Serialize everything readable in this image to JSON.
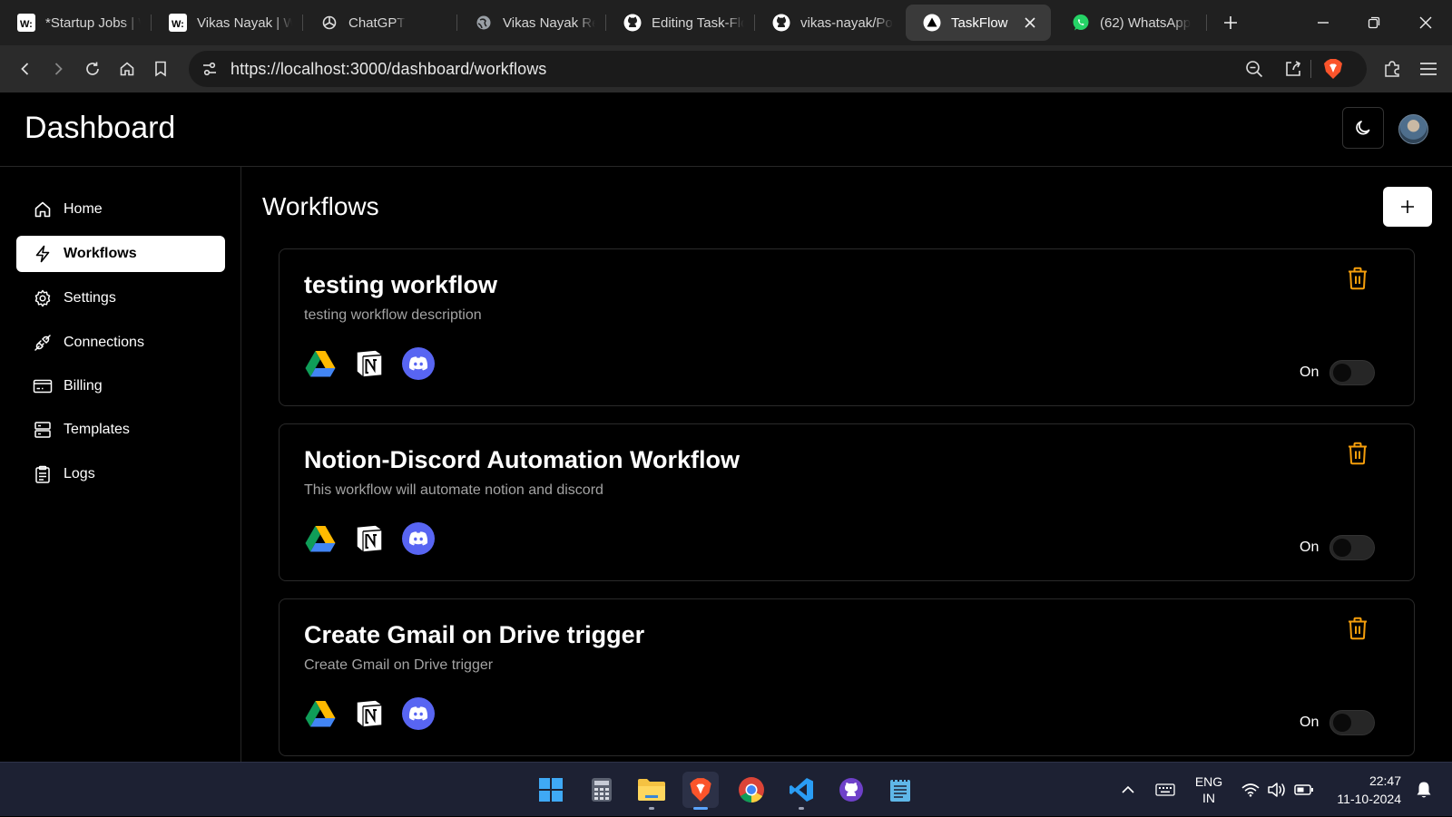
{
  "browser": {
    "tabs": [
      {
        "label": "*Startup Jobs | W",
        "icon": "wellfound-icon",
        "active": false
      },
      {
        "label": "Vikas Nayak | W",
        "icon": "wellfound-icon",
        "active": false
      },
      {
        "label": "ChatGPT",
        "icon": "chatgpt-icon",
        "active": false
      },
      {
        "label": "Vikas Nayak Res",
        "icon": "globe-icon",
        "active": false
      },
      {
        "label": "Editing Task-Flo",
        "icon": "github-icon",
        "active": false
      },
      {
        "label": "vikas-nayak/Pol",
        "icon": "github-icon",
        "active": false
      },
      {
        "label": "TaskFlow",
        "icon": "taskflow-icon",
        "active": true
      },
      {
        "label": "(62) WhatsApp",
        "icon": "whatsapp-icon",
        "active": false
      }
    ],
    "url": "https://localhost:3000/dashboard/workflows"
  },
  "header": {
    "title": "Dashboard"
  },
  "sidebar": {
    "items": [
      {
        "label": "Home",
        "icon": "home-icon",
        "active": false
      },
      {
        "label": "Workflows",
        "icon": "lightning-icon",
        "active": true
      },
      {
        "label": "Settings",
        "icon": "gear-icon",
        "active": false
      },
      {
        "label": "Connections",
        "icon": "plug-icon",
        "active": false
      },
      {
        "label": "Billing",
        "icon": "billing-icon",
        "active": false
      },
      {
        "label": "Templates",
        "icon": "templates-icon",
        "active": false
      },
      {
        "label": "Logs",
        "icon": "clipboard-icon",
        "active": false
      }
    ]
  },
  "main": {
    "title": "Workflows",
    "add_label": "+",
    "workflows": [
      {
        "title": "testing workflow",
        "description": "testing workflow description",
        "icons": [
          "google-drive-icon",
          "notion-icon",
          "discord-icon"
        ],
        "toggle_label": "On",
        "enabled": false
      },
      {
        "title": "Notion-Discord Automation Workflow",
        "description": "This workflow will automate notion and discord",
        "icons": [
          "google-drive-icon",
          "notion-icon",
          "discord-icon"
        ],
        "toggle_label": "On",
        "enabled": false
      },
      {
        "title": "Create Gmail on Drive trigger",
        "description": "Create Gmail on Drive trigger",
        "icons": [
          "google-drive-icon",
          "notion-icon",
          "discord-icon"
        ],
        "toggle_label": "On",
        "enabled": false
      }
    ]
  },
  "taskbar": {
    "apps": [
      "windows-start-icon",
      "calculator-icon",
      "file-explorer-icon",
      "brave-icon",
      "chrome-icon",
      "vscode-icon",
      "github-desktop-icon",
      "notepad-icon"
    ],
    "active_app": "brave-icon",
    "language": {
      "line1": "ENG",
      "line2": "IN"
    },
    "time": "22:47",
    "date": "11-10-2024"
  },
  "colors": {
    "accent_trash": "#f59e0b",
    "discord": "#5865f2",
    "background": "#000000"
  }
}
